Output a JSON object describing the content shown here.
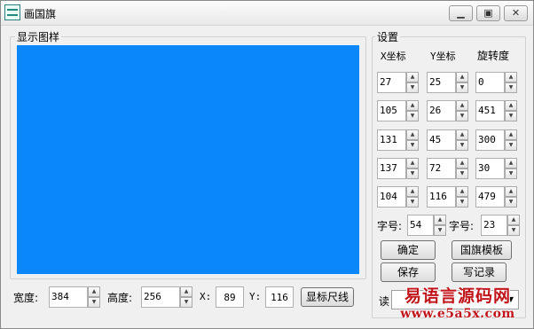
{
  "window": {
    "title": "画国旗"
  },
  "title_buttons": {
    "minimize": "▁",
    "maximize": "▣",
    "close": "✕"
  },
  "preview": {
    "title": "显示图样",
    "color": "#0a88fb"
  },
  "settings": {
    "title": "设置",
    "headers": [
      "X坐标",
      "Y坐标",
      "旋转度"
    ],
    "rows": [
      [
        "27",
        "25",
        "0"
      ],
      [
        "105",
        "26",
        "451"
      ],
      [
        "131",
        "45",
        "300"
      ],
      [
        "137",
        "72",
        "30"
      ],
      [
        "104",
        "116",
        "479"
      ]
    ],
    "font_size_1_label": "字号:",
    "font_size_1_value": "54",
    "font_size_2_label": "字号:",
    "font_size_2_value": "23",
    "buttons": {
      "confirm": "确定",
      "template": "国旗模板",
      "save": "保存",
      "write_record": "写记录"
    },
    "read_label": "读"
  },
  "bottom": {
    "width_label": "宽度:",
    "width_value": "384",
    "height_label": "高度:",
    "height_value": "256",
    "x_label": "X:",
    "x_value": "89",
    "y_label": "Y:",
    "y_value": "116",
    "ruler_button": "显标尺线"
  },
  "watermark": {
    "line1": "易语言源码网",
    "line2": "www.e5a5x.com"
  },
  "icons": {
    "app": "app-flag-icon",
    "spin_up": "spin-up-icon",
    "spin_down": "spin-down-icon",
    "dropdown": "chevron-down-icon"
  }
}
